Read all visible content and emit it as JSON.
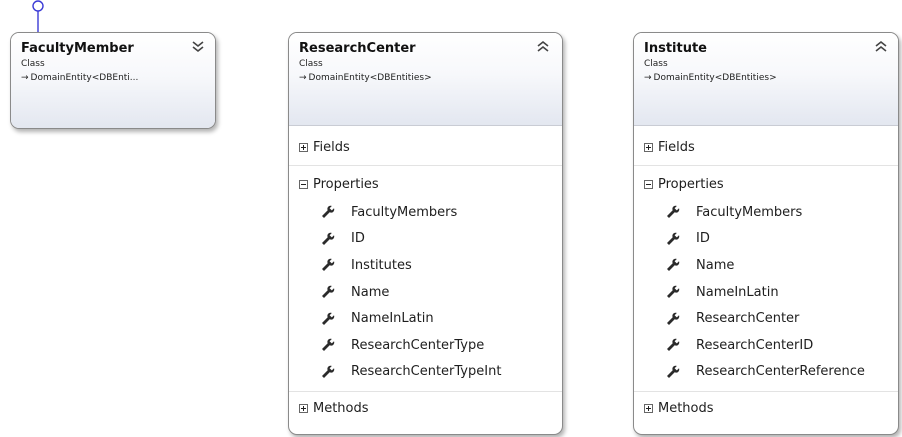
{
  "classes": {
    "faculty_member": {
      "name": "FacultyMember",
      "kind": "Class",
      "base": "DomainEntity<DBEnti...",
      "state": "collapsed"
    },
    "research_center": {
      "name": "ResearchCenter",
      "kind": "Class",
      "base": "DomainEntity<DBEntities>",
      "state": "expanded",
      "sections": {
        "fields": "Fields",
        "properties": "Properties",
        "methods": "Methods"
      },
      "properties": [
        "FacultyMembers",
        "ID",
        "Institutes",
        "Name",
        "NameInLatin",
        "ResearchCenterType",
        "ResearchCenterTypeInt"
      ]
    },
    "institute": {
      "name": "Institute",
      "kind": "Class",
      "base": "DomainEntity<DBEntities>",
      "state": "expanded",
      "sections": {
        "fields": "Fields",
        "properties": "Properties",
        "methods": "Methods"
      },
      "properties": [
        "FacultyMembers",
        "ID",
        "Name",
        "NameInLatin",
        "ResearchCenter",
        "ResearchCenterID",
        "ResearchCenterReference"
      ]
    }
  },
  "colors": {
    "interface_lollipop": "#3b3bd6",
    "border": "#8a8a8a",
    "header_gradient_end": "#e3e7f0",
    "property_icon": "#2b2b2b"
  },
  "icons": {
    "inheritance": "inherits-arrow-icon",
    "collapse": "double-chevron-up-icon",
    "expand": "double-chevron-down-icon",
    "section_collapsed": "plus-box-icon",
    "section_expanded": "minus-box-icon",
    "property": "wrench-icon"
  }
}
